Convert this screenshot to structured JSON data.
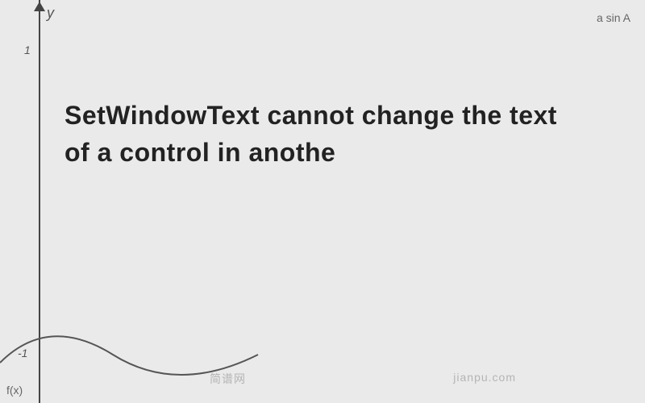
{
  "axis": {
    "y_label": "y",
    "tick_1": "1",
    "tick_neg1": "-1"
  },
  "functions": {
    "asin": "a sin A",
    "fx": "f(x)"
  },
  "main_text": {
    "line1": "SetWindowText",
    "line2": "cannot change",
    "line3": "the text of a control in anothe"
  },
  "watermark": {
    "left": "简谱网",
    "right": "jianpu.com"
  }
}
